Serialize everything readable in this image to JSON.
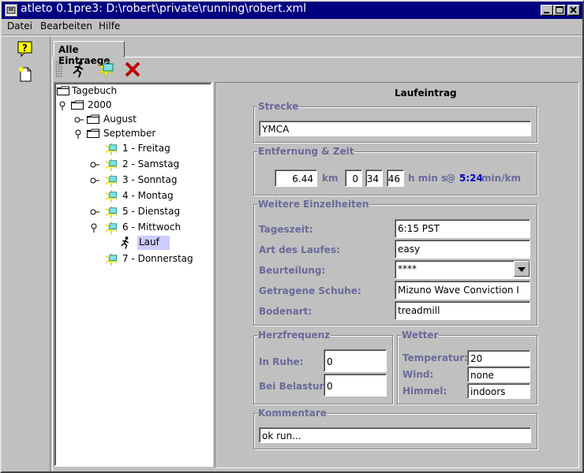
{
  "window": {
    "title": "atleto 0.1pre3: D:\\robert\\private\\running\\robert.xml"
  },
  "menu": [
    "Datei",
    "Bearbeiten",
    "Hilfe"
  ],
  "tab_label": "Alle Eintraege",
  "toolbar": {
    "icons": [
      "runner-icon",
      "new-entry-icon",
      "delete-icon"
    ]
  },
  "tree": {
    "root": "Tagebuch",
    "year": "2000",
    "months": [
      "August",
      "September"
    ],
    "days": [
      "1 - Freitag",
      "2 - Samstag",
      "3 - Sonntag",
      "4 - Montag",
      "5 - Dienstag",
      "6 - Mittwoch",
      "7 - Donnerstag"
    ],
    "selected_leaf": "Lauf"
  },
  "form": {
    "title": "Laufeintrag",
    "strecke": {
      "label": "Strecke",
      "value": "YMCA"
    },
    "distanz": {
      "label": "Entfernung & Zeit",
      "km": "6.44",
      "km_unit": "km",
      "h": "0",
      "min": "34",
      "s": "46",
      "time_unit": "h min s",
      "at": "@",
      "pace": "5:24",
      "pace_unit": "min/km"
    },
    "details": {
      "label": "Weitere Einzelheiten",
      "rows": [
        {
          "label": "Tageszeit:",
          "value": "6:15 PST"
        },
        {
          "label": "Art des Laufes:",
          "value": "easy"
        },
        {
          "label": "Beurteilung:",
          "value": "****"
        },
        {
          "label": "Getragene Schuhe:",
          "value": "Mizuno Wave Conviction I"
        },
        {
          "label": "Bodenart:",
          "value": "treadmill"
        }
      ]
    },
    "herz": {
      "label": "Herzfrequenz",
      "ruhe_label": "In Ruhe:",
      "ruhe_value": "0",
      "belastung_label": "Bei Belastung:",
      "belastung_value": "0"
    },
    "wetter": {
      "label": "Wetter",
      "temp_label": "Temperatur:",
      "temp_value": "20",
      "wind_label": "Wind:",
      "wind_value": "none",
      "himmel_label": "Himmel:",
      "himmel_value": "indoors"
    },
    "kommentare": {
      "label": "Kommentare",
      "value": "ok run..."
    }
  },
  "colors": {
    "titlebar": "#000080",
    "group_label": "#6a6a9a",
    "pace": "#0000c0",
    "selection": "#ccccff"
  }
}
